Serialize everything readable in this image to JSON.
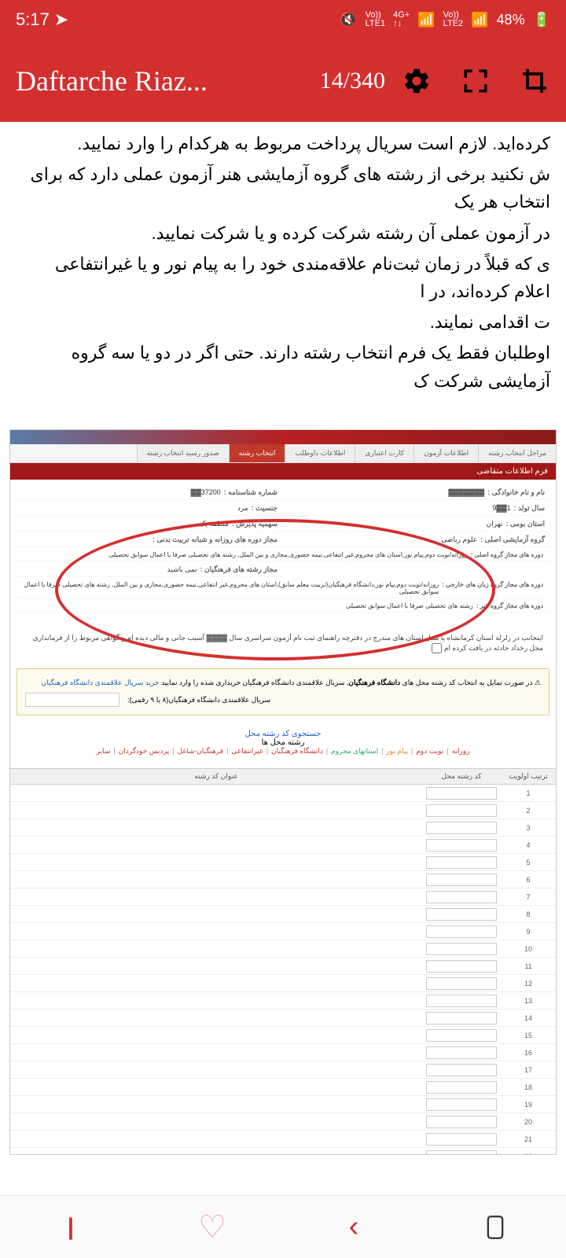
{
  "status": {
    "time": "5:17",
    "location_icon": "➤",
    "lte1": "LTE1",
    "lte2": "LTE2",
    "net": "4G+",
    "vo": "Vo))",
    "battery": "48%"
  },
  "header": {
    "title": "Daftarche Riaz...",
    "page": "14/340"
  },
  "body_text": {
    "p1": "  کرده‌اید. لازم است سریال پرداخت مربوط به هرکدام را وارد نمایید.",
    "p2": "ش نکنید برخی از رشته های گروه آزمایشی هنر آزمون عملی دارد که برای انتخاب هر یک",
    "p3": "در آزمون عملی آن رشته شرکت کرده و یا شرکت نمایید.",
    "p4": "ی که قبلاً در زمان ثبت‌نام علاقه‌مندی خود را به پیام نور و یا غیرانتفاعی اعلام کرده‌اند، در ا",
    "p5": "ت اقدامی نمایند.",
    "p6": "اوطلبان فقط یک فرم انتخاب رشته دارند. حتی اگر در دو یا سه گروه آزمایشی شرکت ک"
  },
  "breadcrumb": {
    "items": [
      "مراحل انتخاب رشته",
      "اطلاعات آزمون",
      "کارت اعتباری",
      "اطلاعات داوطلب",
      "انتخاب رشته",
      "صدور رسید انتخاب رشته"
    ],
    "active_index": 4
  },
  "section_title": "فرم اطلاعات متقاضی",
  "info": {
    "name_label": "نام و نام خانوادگی :",
    "name_value": "▓▓▓▓▓▓▓",
    "id_label": "شماره شناسنامه :",
    "id_value": "37200▓▓",
    "birth_label": "سال تولد :",
    "birth_value": "1▓▓9",
    "gender_label": "جنسیت :",
    "gender_value": "مرد",
    "province_label": "استان بومی :",
    "province_value": "تهران",
    "quota_label": "سهمیه پذیرش :",
    "quota_value": "منطقه یک",
    "group_label": "گروه آزمایشی اصلی :",
    "group_value": "علوم ریاضی",
    "allowed_label": "مجاز دوره های روزانه و شبانه تربیت بدنی :",
    "allowed_value": "",
    "main_courses_label": "دوره های مجاز گروه اصلی :",
    "main_courses_value": "روزانه/نوبت دوم,پیام نور,استان های محروم,غیر انتفاعی,نیمه حضوری,مجازی و بین الملل, رشته های تحصیلی صرفا با اعمال سوابق تحصیلی",
    "farhangian_label": "مجاز رشته های فرهنگیان :",
    "farhangian_value": "نمی باشید",
    "foreign_label": "دوره های مجاز گروه زبان های خارجی :",
    "foreign_value": "روزانه/نوبت دوم,پیام نور,دانشگاه فرهنگیان(تربیت معلم سابق),استان های محروم,غیر انتفاعی,نیمه حضوری,مجازی و بین الملل, رشته های تحصیلی صرفا با اعمال سوابق تحصیلی",
    "art_label": "دوره های مجاز گروه هنر :",
    "art_value": "رشته های تحصیلی صرفا با اعمال سوابق تحصیلی"
  },
  "notice": "اینجانب در زلزله استان کرمانشاه یا سیل استان های مندرج در دفترچه راهنمای ثبت نام آزمون سراسری سال ▓▓▓▓ آسیب جانی و مالی دیده ام و گواهی مربوط را از فرمانداری محل رخداد حادثه در یافت کرده ام",
  "warning": {
    "icon": "⚠",
    "text1": "در صورت تمایل به انتخاب کد رشته محل های ",
    "bold1": "دانشگاه فرهنگیان",
    "text2": ", سریال علاقمندی دانشگاه فرهنگیان خریداری شده را وارد نمایید ",
    "link": "خرید سریال علاقمندی دانشگاه فرهنگیان",
    "serial_label": "سریال علاقمندی دانشگاه فرهنگیان(۸ یا ۹ رقمی):"
  },
  "search": {
    "link": "جستجوی کد رشته محل",
    "subtitle": "رشته محل ها"
  },
  "filters": [
    "روزانه",
    "نوبت دوم",
    "پیام نور",
    "استانهای محروم",
    "دانشگاه فرهنگیان",
    "غیرانتفاعی",
    "فرهنگیان-شاغل",
    "پردیس خودگردان",
    "سایر"
  ],
  "table": {
    "col_priority": "ترتیب اولویت",
    "col_code": "کد رشته محل",
    "col_title": "عنوان کد رشته",
    "row_count": 22
  }
}
